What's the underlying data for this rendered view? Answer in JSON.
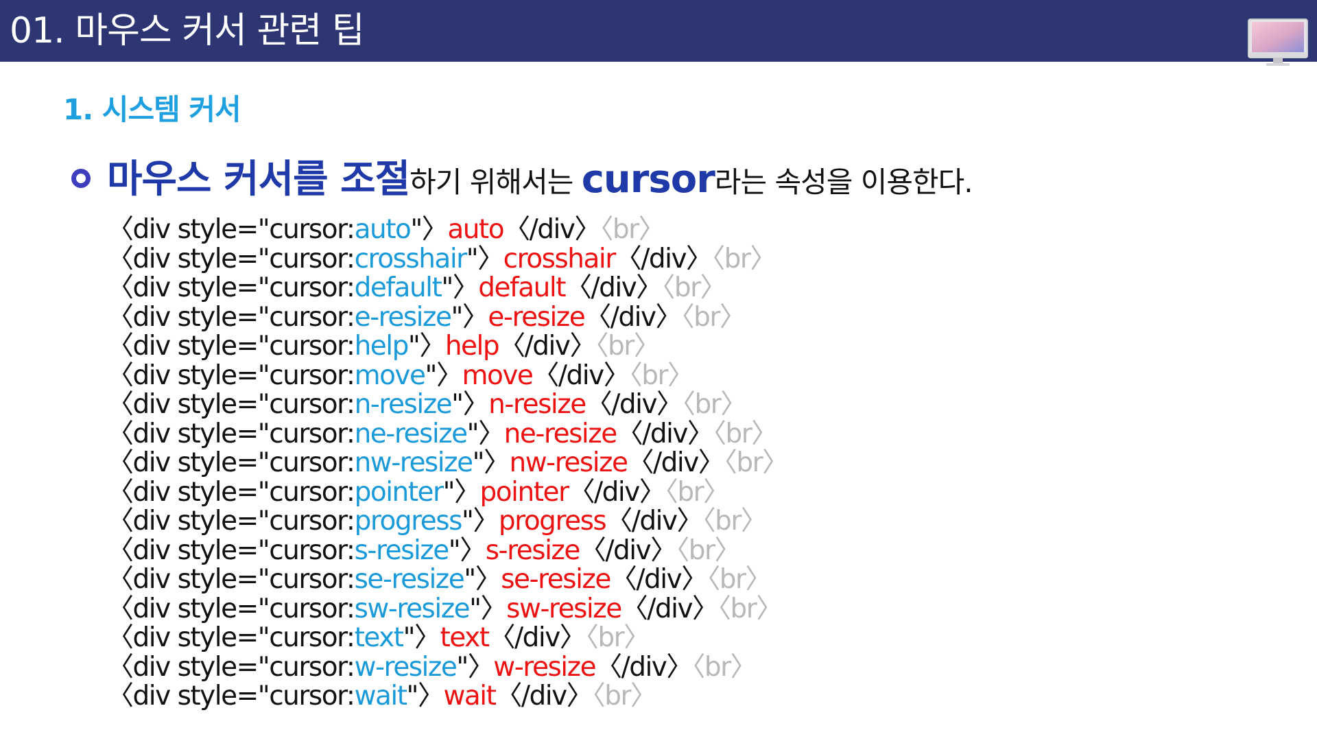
{
  "header": {
    "title": "01. 마우스 커서 관련 팁"
  },
  "section": {
    "title": "1. 시스템 커서"
  },
  "bullet": {
    "part1": "마우스 커서를 조절",
    "part2": "하기 위해서는 ",
    "part3": "cursor",
    "part4": "라는 속성을 이용한다."
  },
  "code": {
    "prefix": "〈div style=\"cursor:",
    "mid": "\"〉",
    "close": "〈/div〉",
    "br": "〈br〉",
    "values": [
      "auto",
      "crosshair",
      "default",
      "e-resize",
      "help",
      "move",
      "n-resize",
      "ne-resize",
      "nw-resize",
      "pointer",
      "progress",
      "s-resize",
      "se-resize",
      "sw-resize",
      "text",
      "w-resize",
      "wait"
    ]
  },
  "colors": {
    "header_bg": "#2d3572",
    "section_title": "#1ea0e0",
    "bullet_strong": "#1f3aa8",
    "code_value": "#1a9ad9",
    "code_text": "#ee1111",
    "code_br": "#b8b8b8"
  },
  "icons": {
    "header_icon": "monitor-icon"
  }
}
